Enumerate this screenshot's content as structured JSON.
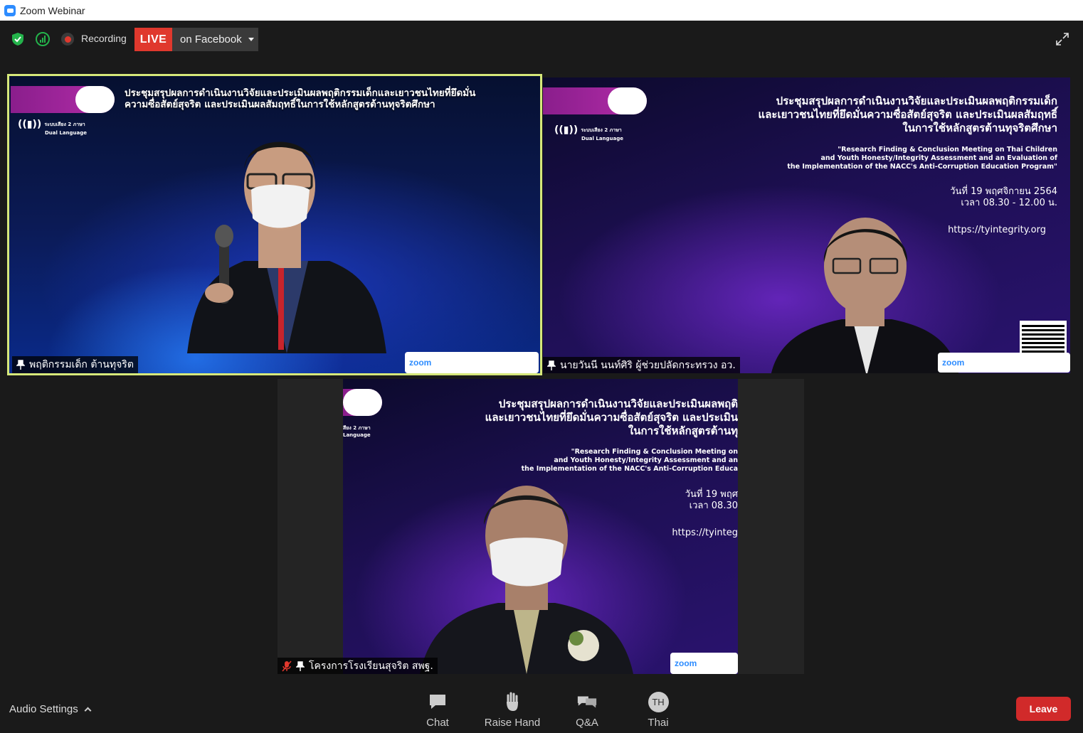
{
  "window": {
    "title": "Zoom Webinar"
  },
  "topbar": {
    "recording_label": "Recording",
    "live_label": "LIVE",
    "live_target": "on Facebook"
  },
  "tiles": [
    {
      "id": "tile-1",
      "title_line1": "ประชุมสรุปผลการดำเนินงานวิจัยและประเมินผลพฤติกรรมเด็กและเยาวชนไทยที่ยึดมั่น",
      "title_line2": "ความซื่อสัตย์สุจริต และประเมินผลสัมฤทธิ์ในการใช้หลักสูตรต้านทุจริตศึกษา",
      "dual_line1": "ระบบเสียง 2 ภาษา",
      "dual_line2": "Dual Language",
      "name": "พฤติกรรมเด็ก ต้านทุจริต",
      "zoom_logo": "zoom"
    },
    {
      "id": "tile-2",
      "title_line1": "ประชุมสรุปผลการดำเนินงานวิจัยและประเมินผลพฤติกรรมเด็ก",
      "title_line2": "และเยาวชนไทยที่ยึดมั่นความซื่อสัตย์สุจริต และประเมินผลสัมฤทธิ์",
      "title_line3": "ในการใช้หลักสูตรต้านทุจริตศึกษา",
      "en_line1": "\"Research Finding & Conclusion Meeting on Thai Children",
      "en_line2": "and Youth Honesty/Integrity Assessment and an Evaluation of",
      "en_line3": "the Implementation of the NACC's Anti-Corruption Education Program\"",
      "date": "วันที่ 19 พฤศจิกายน 2564",
      "time": "เวลา 08.30 - 12.00 น.",
      "url": "https://tyintegrity.org",
      "dual_line1": "ระบบเสียง 2 ภาษา",
      "dual_line2": "Dual Language",
      "name": "นายวันนี นนท์ศิริ ผู้ช่วยปลัดกระทรวง อว.",
      "zoom_logo": "zoom"
    },
    {
      "id": "tile-3",
      "title_line1": "ประชุมสรุปผลการดำเนินงานวิจัยและประเมินผลพฤติ",
      "title_line2": "และเยาวชนไทยที่ยึดมั่นความซื่อสัตย์สุจริต และประเมิน",
      "title_line3": "ในการใช้หลักสูตรต้านทุ",
      "en_line1": "\"Research Finding & Conclusion Meeting on",
      "en_line2": "and Youth Honesty/Integrity Assessment and an",
      "en_line3": "the Implementation of the NACC's Anti-Corruption Educa",
      "date": "วันที่ 19 พฤศ",
      "time": "เวลา 08.30",
      "url": "https://tyinteg",
      "dual_line1": "สียง 2 ภาษา",
      "dual_line2": "Language",
      "name": "โครงการโรงเรียนสุจริต สพฐ.",
      "zoom_logo": "zoom"
    }
  ],
  "toolbar": {
    "audio_settings": "Audio Settings",
    "chat": "Chat",
    "raise_hand": "Raise Hand",
    "qa": "Q&A",
    "language_badge": "TH",
    "language": "Thai",
    "leave": "Leave"
  },
  "colors": {
    "live_red": "#e0382d",
    "active_speaker_border": "#d6e87a",
    "leave_red": "#d12a2a",
    "zoom_blue": "#2d8cff"
  }
}
